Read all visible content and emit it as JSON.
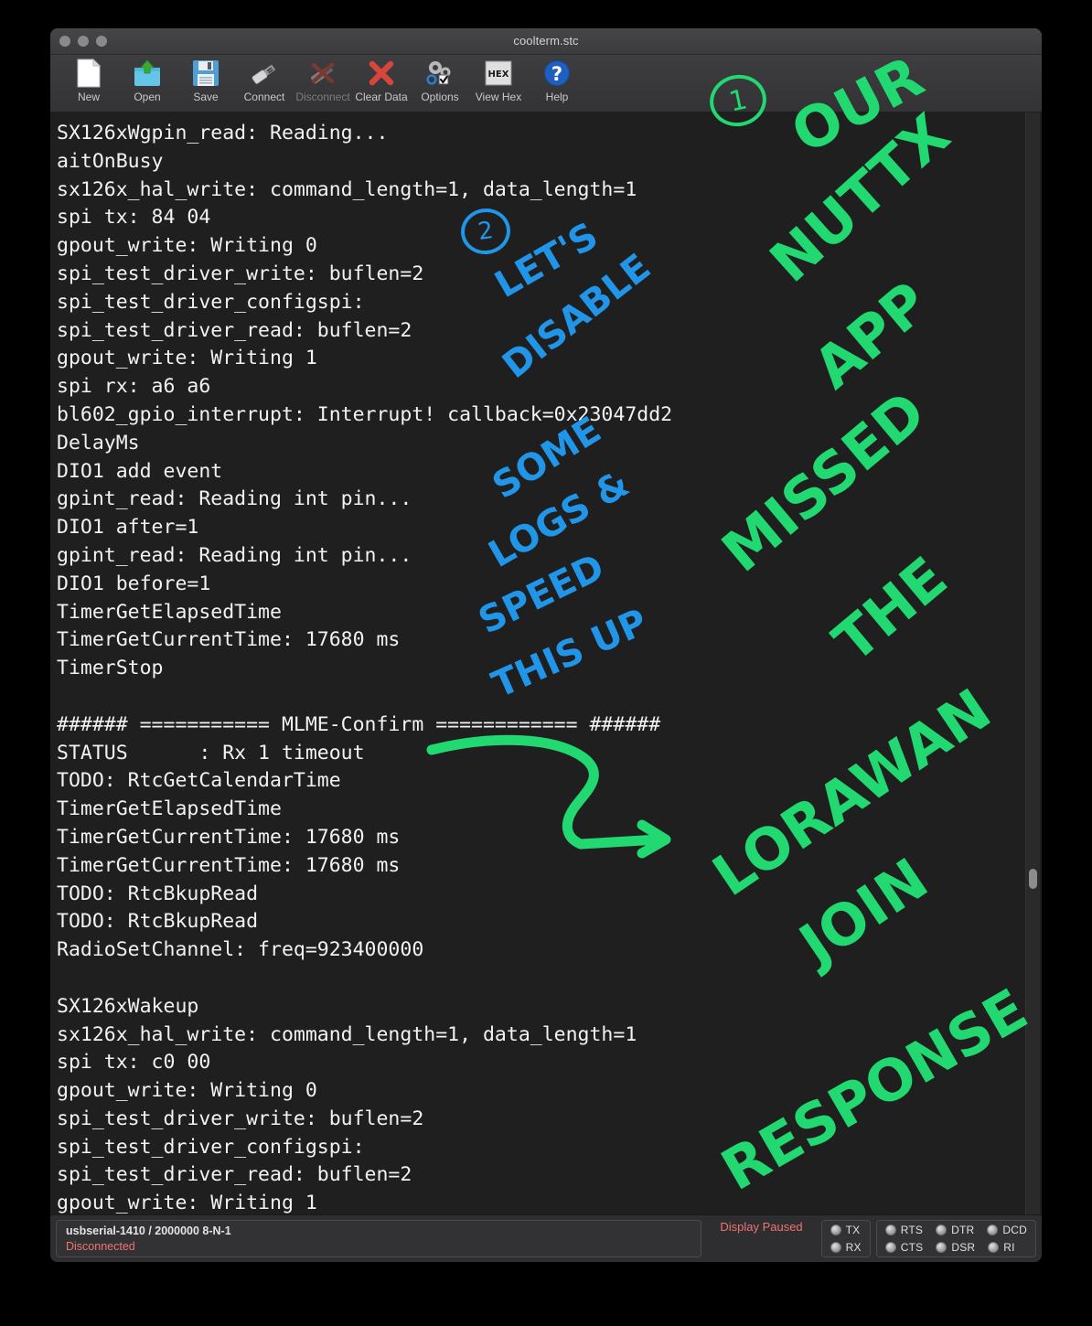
{
  "window": {
    "title": "coolterm.stc"
  },
  "toolbar": {
    "items": [
      {
        "label": "New",
        "icon": "new-document-icon",
        "disabled": false
      },
      {
        "label": "Open",
        "icon": "open-folder-icon",
        "disabled": false
      },
      {
        "label": "Save",
        "icon": "floppy-disk-icon",
        "disabled": false
      },
      {
        "label": "Connect",
        "icon": "usb-plug-icon",
        "disabled": false
      },
      {
        "label": "Disconnect",
        "icon": "usb-disconnect-icon",
        "disabled": true
      },
      {
        "label": "Clear Data",
        "icon": "red-x-icon",
        "disabled": false
      },
      {
        "label": "Options",
        "icon": "gears-icon",
        "disabled": false
      },
      {
        "label": "View Hex",
        "icon": "hex-icon",
        "disabled": false
      },
      {
        "label": "Help",
        "icon": "question-mark-icon",
        "disabled": false
      }
    ],
    "hex_label": "HEX"
  },
  "terminal": {
    "lines": [
      "SX126xWgpin_read: Reading...",
      "aitOnBusy",
      "sx126x_hal_write: command_length=1, data_length=1",
      "spi tx: 84 04",
      "gpout_write: Writing 0",
      "spi_test_driver_write: buflen=2",
      "spi_test_driver_configspi:",
      "spi_test_driver_read: buflen=2",
      "gpout_write: Writing 1",
      "spi rx: a6 a6",
      "bl602_gpio_interrupt: Interrupt! callback=0x23047dd2",
      "DelayMs",
      "DIO1 add event",
      "gpint_read: Reading int pin...",
      "DIO1 after=1",
      "gpint_read: Reading int pin...",
      "DIO1 before=1",
      "TimerGetElapsedTime",
      "TimerGetCurrentTime: 17680 ms",
      "TimerStop",
      "",
      "###### =========== MLME-Confirm ============ ######",
      "STATUS      : Rx 1 timeout",
      "TODO: RtcGetCalendarTime",
      "TimerGetElapsedTime",
      "TimerGetCurrentTime: 17680 ms",
      "TimerGetCurrentTime: 17680 ms",
      "TODO: RtcBkupRead",
      "TODO: RtcBkupRead",
      "RadioSetChannel: freq=923400000",
      "",
      "SX126xWakeup",
      "sx126x_hal_write: command_length=1, data_length=1",
      "spi tx: c0 00",
      "gpout_write: Writing 0",
      "spi_test_driver_write: buflen=2",
      "spi_test_driver_configspi:",
      "spi_test_driver_read: buflen=2",
      "gpout_write: Writing 1"
    ]
  },
  "statusbar": {
    "port": "usbserial-1410 / 2000000 8-N-1",
    "connection_state": "Disconnected",
    "display_state": "Display Paused",
    "txrx_leds": [
      {
        "label": "TX",
        "on": false
      },
      {
        "label": "RX",
        "on": false
      }
    ],
    "signal_leds_row1": [
      {
        "label": "RTS",
        "on": false
      },
      {
        "label": "DTR",
        "on": false
      },
      {
        "label": "DCD",
        "on": false
      }
    ],
    "signal_leds_row2": [
      {
        "label": "CTS",
        "on": false
      },
      {
        "label": "DSR",
        "on": false
      },
      {
        "label": "RI",
        "on": false
      }
    ]
  },
  "annotations": {
    "colors": {
      "green": "#21d970",
      "blue": "#2196e8"
    },
    "marker_1": "1",
    "marker_2": "2",
    "green_words": [
      "OUR",
      "NUTTX",
      "APP",
      "MISSED",
      "THE",
      "LORAWAN",
      "JOIN",
      "RESPONSE"
    ],
    "blue_words": [
      "LET'S",
      "DISABLE",
      "SOME",
      "LOGS &",
      "SPEED",
      "THIS UP"
    ]
  }
}
